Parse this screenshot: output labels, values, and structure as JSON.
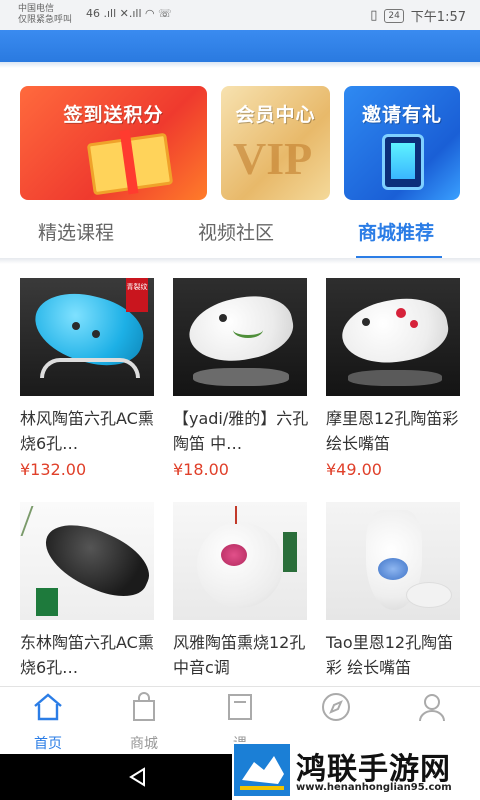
{
  "status_bar": {
    "carrier": "中国电信",
    "carrier_sub": "仅限紧急呼叫",
    "signal_text": "46 .ıll ✕.ıll",
    "battery": "24",
    "time": "下午1:57"
  },
  "banners": [
    {
      "text": "签到送积分"
    },
    {
      "text": "会员中心",
      "art": "VIP"
    },
    {
      "text": "邀请有礼"
    }
  ],
  "tabs": [
    {
      "label": "精选课程"
    },
    {
      "label": "视频社区"
    },
    {
      "label": "商城推荐"
    }
  ],
  "products": [
    {
      "title": "林风陶笛六孔AC熏 烧6孔…",
      "price": "¥132.00",
      "tag": "青裂纹"
    },
    {
      "title": "【yadi/雅的】六孔 陶笛 中…",
      "price": "¥18.00"
    },
    {
      "title": "摩里恩12孔陶笛彩 绘长嘴笛",
      "price": "¥49.00"
    },
    {
      "title": "东林陶笛六孔AC熏 烧6孔…",
      "price": ""
    },
    {
      "title": "风雅陶笛熏烧12孔 中音c调",
      "price": ""
    },
    {
      "title": "Tao里恩12孔陶笛彩 绘长嘴笛",
      "price": ""
    }
  ],
  "bottom_nav": [
    {
      "label": "首页",
      "icon": "home-icon",
      "active": true
    },
    {
      "label": "商城",
      "icon": "shopping-bag-icon"
    },
    {
      "label": "课",
      "icon": "book-icon"
    },
    {
      "label": "",
      "icon": "compass-icon"
    },
    {
      "label": "",
      "icon": "user-icon"
    }
  ],
  "watermark": {
    "title": "鸿联手游网",
    "url": "www.henanhonglian95.com"
  },
  "colors": {
    "accent": "#2b7de6",
    "price": "#e0402a",
    "header": "#3a8bf0"
  }
}
